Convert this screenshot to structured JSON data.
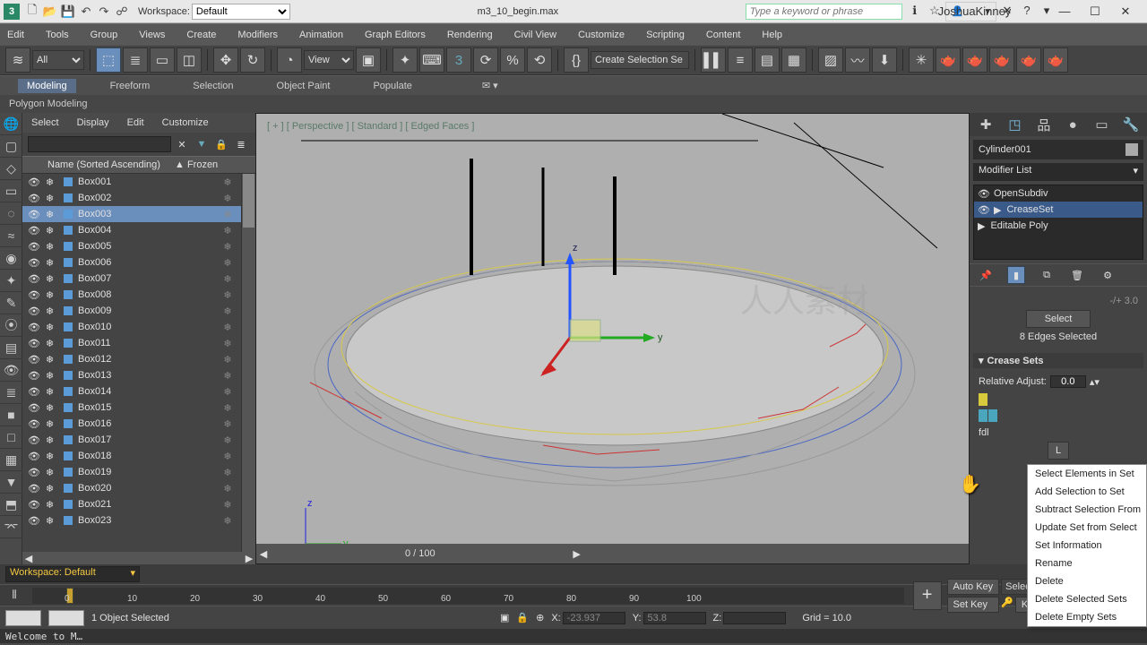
{
  "title": {
    "filename": "m3_10_begin.max",
    "workspace_label": "Workspace:",
    "workspace_value": "Default",
    "search_placeholder": "Type a keyword or phrase",
    "username": "JoshuaKinney"
  },
  "menus": [
    "Edit",
    "Tools",
    "Group",
    "Views",
    "Create",
    "Modifiers",
    "Animation",
    "Graph Editors",
    "Rendering",
    "Civil View",
    "Customize",
    "Scripting",
    "Content",
    "Help"
  ],
  "main_toolbar": {
    "type_filter": "All",
    "ref_dropdown": "View",
    "selset": "Create Selection Se"
  },
  "ribbon_tabs": [
    "Modeling",
    "Freeform",
    "Selection",
    "Object Paint",
    "Populate"
  ],
  "ribbon_sub": "Polygon Modeling",
  "scene_explorer": {
    "menus": [
      "Select",
      "Display",
      "Edit",
      "Customize"
    ],
    "col1": "Name (Sorted Ascending)",
    "col2": "▲ Frozen",
    "items": [
      {
        "name": "Box001"
      },
      {
        "name": "Box002"
      },
      {
        "name": "Box003",
        "selected": true
      },
      {
        "name": "Box004"
      },
      {
        "name": "Box005"
      },
      {
        "name": "Box006"
      },
      {
        "name": "Box007"
      },
      {
        "name": "Box008"
      },
      {
        "name": "Box009"
      },
      {
        "name": "Box010"
      },
      {
        "name": "Box011"
      },
      {
        "name": "Box012"
      },
      {
        "name": "Box013"
      },
      {
        "name": "Box014"
      },
      {
        "name": "Box015"
      },
      {
        "name": "Box016"
      },
      {
        "name": "Box017"
      },
      {
        "name": "Box018"
      },
      {
        "name": "Box019"
      },
      {
        "name": "Box020"
      },
      {
        "name": "Box021"
      },
      {
        "name": "Box023"
      }
    ]
  },
  "viewport": {
    "label": "[ + ] [ Perspective ] [ Standard ] [ Edged Faces ]",
    "timeline_text": "0 / 100",
    "axes": {
      "x": "x",
      "y": "y",
      "z": "z"
    }
  },
  "cmd": {
    "object_name": "Cylinder001",
    "modlist": "Modifier List",
    "stack": [
      "OpenSubdiv",
      "CreaseSet",
      "Editable Poly"
    ],
    "select_frag": "-/+   3.0",
    "select_btn": "Select",
    "selected_info": "8 Edges Selected",
    "crease_sets_title": "Crease Sets",
    "rel_adjust_label": "Relative Adjust:",
    "rel_adjust_value": "0.0",
    "set_name_frag": "fdl",
    "load_btn": "L"
  },
  "context_menu": [
    "Select Elements in Set",
    "Add Selection to Set",
    "Subtract Selection From",
    "Update Set from Select",
    "Set Information",
    "Rename",
    "Delete",
    "Delete Selected Sets",
    "Delete Empty Sets"
  ],
  "bottom": {
    "workspace": "Workspace: Default",
    "selection_info": "1 Object Selected",
    "x_label": "X:",
    "x_val": "-23.937",
    "y_label": "Y:",
    "y_val": "53.8",
    "z_label": "Z:",
    "z_val": "",
    "grid": "Grid = 10.0",
    "add_time_tag": "Add Time Tag",
    "auto_key": "Auto Key",
    "set_key": "Set Key",
    "key_filters": "Key Filters...",
    "selected": "Selected",
    "ticks": [
      "0",
      "10",
      "20",
      "30",
      "40",
      "50",
      "60",
      "70",
      "80",
      "90",
      "100"
    ],
    "welcome": "Welcome to M…"
  }
}
